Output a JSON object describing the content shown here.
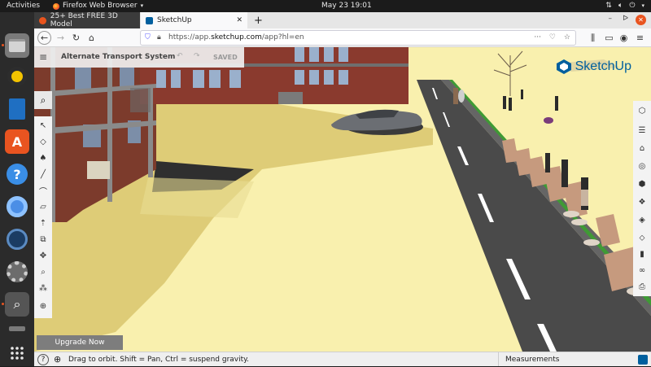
{
  "os": {
    "activities": "Activities",
    "app_name": "Firefox Web Browser",
    "clock": "May 23  19:01",
    "accent": "#e95420"
  },
  "dock": {
    "items": [
      "files-icon",
      "rhythmbox-icon",
      "libreoffice-writer-icon",
      "app-center-icon",
      "help-icon",
      "chromium-icon",
      "steam-icon",
      "settings-icon",
      "search-tool-icon",
      "trash-icon",
      "show-apps-icon"
    ]
  },
  "browser": {
    "tabs": [
      {
        "title": "25+ Best FREE 3D Model"
      },
      {
        "title": "SketchUp"
      }
    ],
    "url": "https://app.sketchup.com/app?hl=en",
    "url_domain": "sketchup.com",
    "url_prefix": "https://app.",
    "url_suffix": "/app?hl=en"
  },
  "sketchup": {
    "model_name": "Alternate Transport System",
    "save_status": "SAVED",
    "brand": "SketchUp",
    "upgrade_label": "Upgrade Now",
    "status_hint": "Drag to orbit. Shift = Pan, Ctrl = suspend gravity.",
    "measurements_label": "Measurements",
    "brand_color": "#005f9e",
    "sky_color": "#f9f0ae",
    "road_color": "#4a4a4a"
  }
}
